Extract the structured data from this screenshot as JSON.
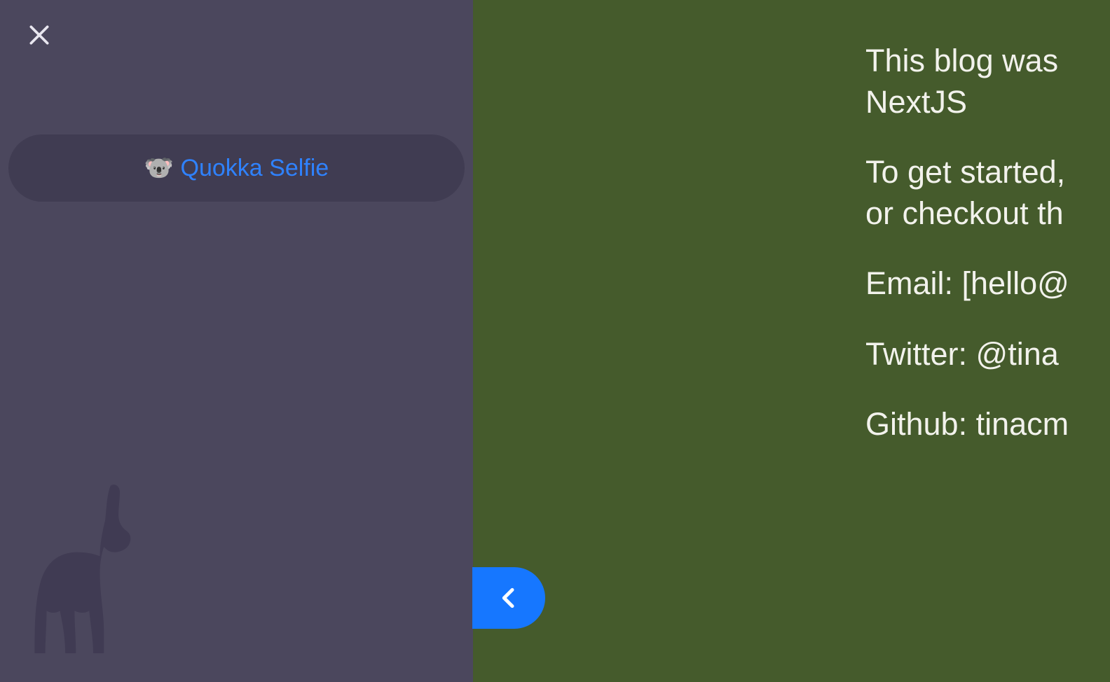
{
  "sidebar": {
    "title_input_value": "🐨 Quokka Selfie"
  },
  "content": {
    "p1": "This blog was\nNextJS",
    "p2": "To get started,\nor checkout th",
    "p3": "Email: [hello@",
    "p4": "Twitter: @tina",
    "p5": "Github: tinacm"
  },
  "colors": {
    "sidebar_bg": "#4b475d",
    "sidebar_input_bg": "#403c52",
    "input_text": "#2f82ff",
    "main_bg": "#455b2c",
    "main_text": "#f2f2ec",
    "accent_blue": "#1677ff"
  }
}
